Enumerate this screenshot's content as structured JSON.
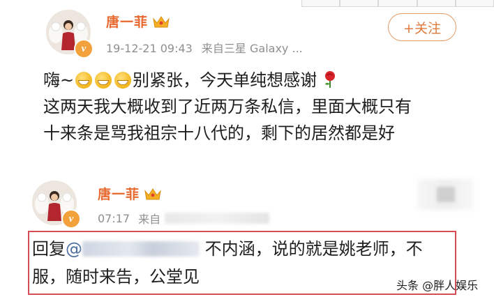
{
  "post": {
    "author": "唐一菲",
    "timestamp": "19-12-21 09:43",
    "source": "来自三星 Galaxy ...",
    "follow_label": "+关注",
    "line1_prefix": "嗨~",
    "line1_text": "别紧张，今天单纯想感谢",
    "line2": "这两天我大概收到了近两万条私信，里面大概只有",
    "line3": "十来条是骂我祖宗十八代的，剩下的居然都是好"
  },
  "reply": {
    "author": "唐一菲",
    "time": "07:17",
    "source_prefix": "来自",
    "prefix": "回复",
    "at": "@",
    "text1": "不内涵，说的就是姚老师，不",
    "text2": "服，随时来告，公堂见"
  },
  "watermark": "头条 @胖人娱乐",
  "colors": {
    "name": "#e8682e",
    "meta": "#8f8f8f",
    "reply_border": "#d64c54",
    "mention": "#4a6d9e"
  },
  "icons": [
    "crown-icon",
    "verified-badge-icon",
    "grin-emoji-icon",
    "rose-icon"
  ]
}
